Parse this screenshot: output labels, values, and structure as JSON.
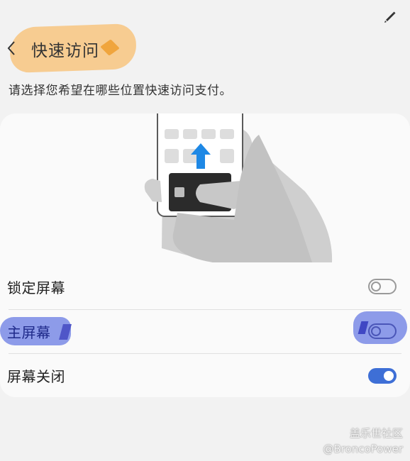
{
  "header": {
    "title": "快速访问",
    "subtitle": "请选择您希望在哪些位置快速访问支付。"
  },
  "settings": [
    {
      "label": "锁定屏幕",
      "enabled": false
    },
    {
      "label": "主屏幕",
      "enabled": false
    },
    {
      "label": "屏幕关闭",
      "enabled": true
    }
  ],
  "watermark": {
    "line1": "盖乐世社区",
    "line2": "@BroncoPower"
  },
  "colors": {
    "toggle_on": "#3e6fd6",
    "highlight_orange": "#f7c98b",
    "highlight_blue": "#8796e8",
    "arrow_blue": "#1e88e5"
  },
  "icons": [
    "pen-icon",
    "back-arrow-icon",
    "phone-swipe-illustration",
    "upward-arrow-icon",
    "payment-card-icon"
  ]
}
